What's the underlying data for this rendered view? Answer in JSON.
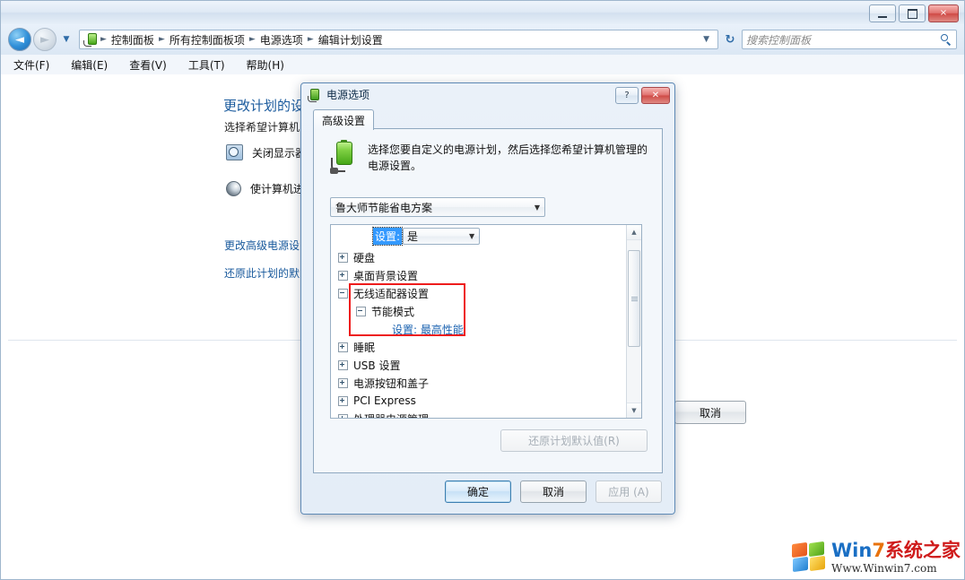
{
  "explorer": {
    "window_buttons": {
      "minimize": "minimize-button",
      "maximize": "maximize-button",
      "close": "×"
    },
    "breadcrumb": [
      "控制面板",
      "所有控制面板项",
      "电源选项",
      "编辑计划设置"
    ],
    "search": {
      "placeholder": "搜索控制面板",
      "value": ""
    },
    "menu": [
      "文件(F)",
      "编辑(E)",
      "查看(V)",
      "工具(T)",
      "帮助(H)"
    ],
    "page": {
      "title": "更改计划的设",
      "subtitle": "选择希望计算机",
      "rows": [
        {
          "label": "关闭显示器"
        },
        {
          "label": "使计算机进"
        }
      ],
      "links": [
        "更改高级电源设",
        "还原此计划的默"
      ],
      "cancel_label": "取消"
    }
  },
  "watermark": {
    "brand_part1": "Win",
    "brand_part2": "7",
    "brand_part3": "系统之家",
    "url": "Www.Winwin7.com"
  },
  "dialog": {
    "title": "电源选项",
    "help_label": "?",
    "close_label": "✕",
    "tab": "高级设置",
    "description": "选择您要自定义的电源计划，然后选择您希望计算机管理的电源设置。",
    "plan_selected": "鲁大师节能省电方案",
    "top_setting": {
      "label": "设置:",
      "value": "是"
    },
    "tree": [
      {
        "label": "硬盘",
        "state": "collapsed",
        "indent": 0,
        "blue": false
      },
      {
        "label": "桌面背景设置",
        "state": "collapsed",
        "indent": 0,
        "blue": false
      },
      {
        "label": "无线适配器设置",
        "state": "expanded",
        "indent": 0,
        "blue": false
      },
      {
        "label": "节能模式",
        "state": "expanded",
        "indent": 1,
        "blue": false
      },
      {
        "label": "设置: 最高性能",
        "state": "leaf",
        "indent": 2,
        "blue": true
      },
      {
        "label": "睡眠",
        "state": "collapsed",
        "indent": 0,
        "blue": false
      },
      {
        "label": "USB 设置",
        "state": "collapsed",
        "indent": 0,
        "blue": false
      },
      {
        "label": "电源按钮和盖子",
        "state": "collapsed",
        "indent": 0,
        "blue": false
      },
      {
        "label": "PCI Express",
        "state": "collapsed",
        "indent": 0,
        "blue": false
      },
      {
        "label": "处理器电源管理",
        "state": "collapsed",
        "indent": 0,
        "blue": false
      }
    ],
    "restore_defaults": "还原计划默认值(R)",
    "buttons": {
      "ok": "确定",
      "cancel": "取消",
      "apply": "应用 (A)"
    },
    "highlight_color": "#ee1c1c"
  }
}
